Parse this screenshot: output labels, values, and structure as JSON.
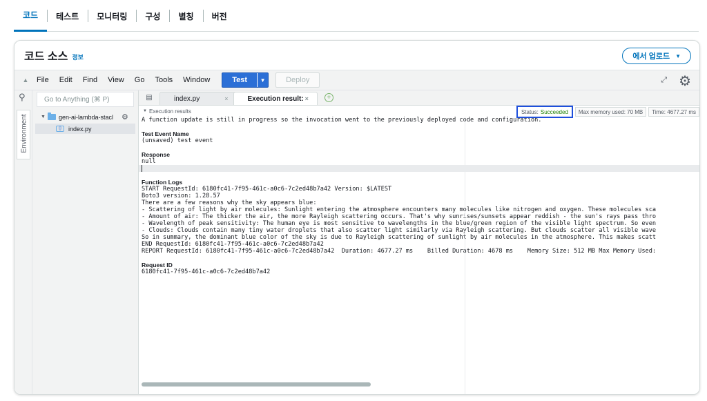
{
  "top_tabs": [
    "코드",
    "테스트",
    "모니터링",
    "구성",
    "별칭",
    "버전"
  ],
  "card": {
    "title": "코드 소스",
    "info": "정보",
    "upload_label": "에서 업로드",
    "upload_caret": "▼"
  },
  "menubar": {
    "items": [
      "File",
      "Edit",
      "Find",
      "View",
      "Go",
      "Tools",
      "Window"
    ],
    "test_label": "Test",
    "test_caret": "▼",
    "deploy_label": "Deploy"
  },
  "sidebar": {
    "vertical_label": "Environment"
  },
  "filetree": {
    "goto_placeholder": "Go to Anything (⌘ P)",
    "folder": "gen-ai-lambda-stacl",
    "file": "index.py"
  },
  "editor": {
    "tabs": [
      {
        "label": "index.py",
        "close": "×"
      },
      {
        "label": "Execution result:",
        "close": "×"
      }
    ],
    "plus": "+"
  },
  "results": {
    "header": "Execution results",
    "status_label": "Status:",
    "status_value": "Succeeded",
    "max_memory": "Max memory used: 70 MB",
    "time": "Time: 4677.27 ms",
    "notice": "A function update is still in progress so the invocation went to the previously deployed code and configuration.",
    "test_event_title": "Test Event Name",
    "test_event_value": "(unsaved) test event",
    "response_title": "Response",
    "response_value": "null",
    "logs_title": "Function Logs",
    "logs": [
      "START RequestId: 6180fc41-7f95-461c-a0c6-7c2ed48b7a42 Version: $LATEST",
      "Boto3 version: 1.28.57",
      "There are a few reasons why the sky appears blue:",
      "- Scattering of light by air molecules: Sunlight entering the atmosphere encounters many molecules like nitrogen and oxygen. These molecules sca",
      "- Amount of air: The thicker the air, the more Rayleigh scattering occurs. That's why sunrises/sunsets appear reddish - the sun's rays pass thro",
      "- Wavelength of peak sensitivity: The human eye is most sensitive to wavelengths in the blue/green region of the visible light spectrum. So even",
      "- Clouds: Clouds contain many tiny water droplets that also scatter light similarly via Rayleigh scattering. But clouds scatter all visible wave",
      "So in summary, the dominant blue color of the sky is due to Rayleigh scattering of sunlight by air molecules in the atmosphere. This makes scatt",
      "END RequestId: 6180fc41-7f95-461c-a0c6-7c2ed48b7a42",
      "REPORT RequestId: 6180fc41-7f95-461c-a0c6-7c2ed48b7a42  Duration: 4677.27 ms    Billed Duration: 4678 ms    Memory Size: 512 MB Max Memory Used:"
    ],
    "request_id_title": "Request ID",
    "request_id_value": "6180fc41-7f95-461c-a0c6-7c2ed48b7a42"
  }
}
